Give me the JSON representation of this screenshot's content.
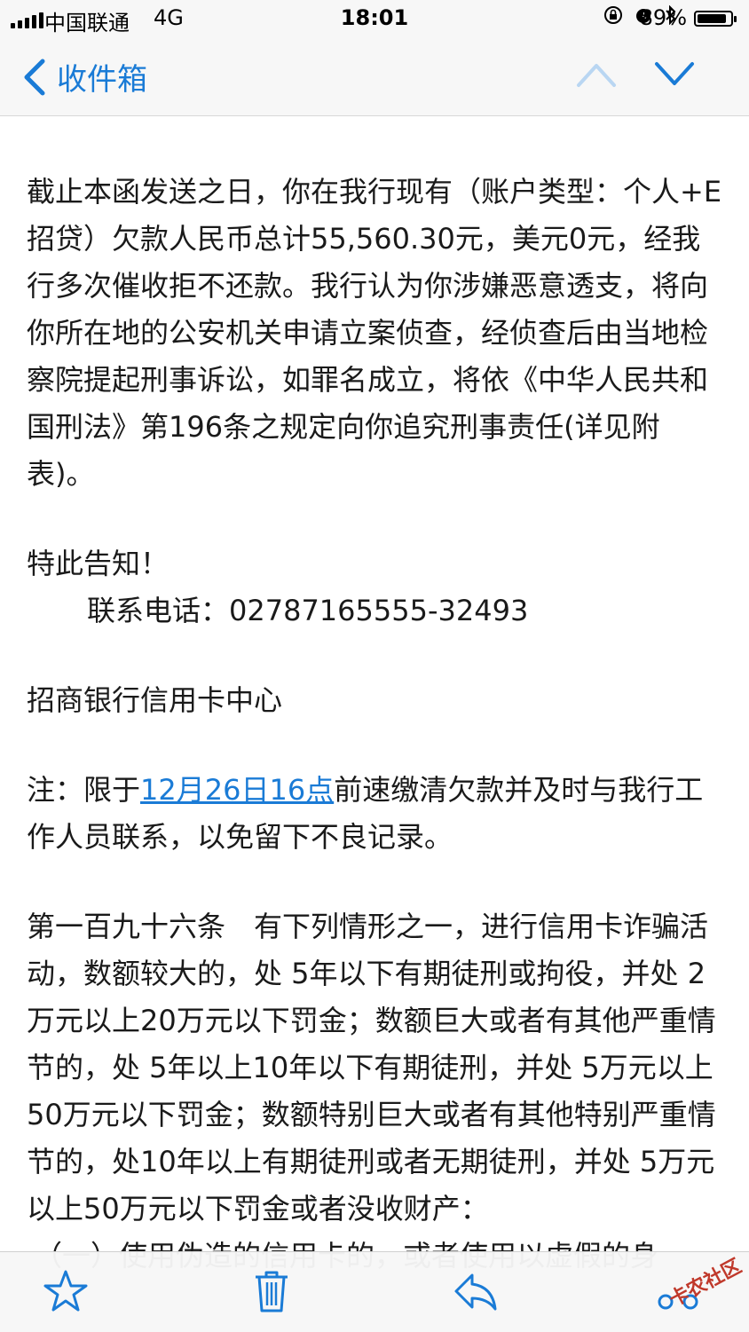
{
  "status": {
    "carrier": "中国联通",
    "network": "4G",
    "time": "18:01",
    "battery": "89%",
    "battery_level": 0.89
  },
  "nav": {
    "back_label": "收件箱"
  },
  "body": {
    "p1_a": "截止本函发送之日，你在我行现有（账户类型：个人+E招贷）欠款人民币总计55,560.30元，美元0元，经我行多次催收拒不还款。我行认为你涉嫌恶意透支，将向你所在地的公安机关申请立案侦查，经侦查后由当地检察院提起刑事诉讼，如罪名成立，将依《中华人民共和国刑法》第196条之规定向你追究刑事责任(详见附表)。",
    "notice": "特此告知！",
    "phone": "联系电话：02787165555-32493",
    "sender": "招商银行信用卡中心",
    "note_prefix": "注：限于",
    "note_link": "12月26日16点",
    "note_suffix": "前速缴清欠款并及时与我行工作人员联系，以免留下不良记录。",
    "law": "第一百九十六条　有下列情形之一，进行信用卡诈骗活动，数额较大的，处 5年以下有期徒刑或拘役，并处 2万元以上20万元以下罚金；数额巨大或者有其他严重情节的，处 5年以上10年以下有期徒刑，并处 5万元以上50万元以下罚金；数额特别巨大或者有其他特别严重情节的，处10年以上有期徒刑或者无期徒刑，并处 5万元以上50万元以下罚金或者没收财产：",
    "law_item1": "（一）使用伪造的信用卡的，或者使用以虚假的身"
  },
  "watermark": "卡农社区"
}
